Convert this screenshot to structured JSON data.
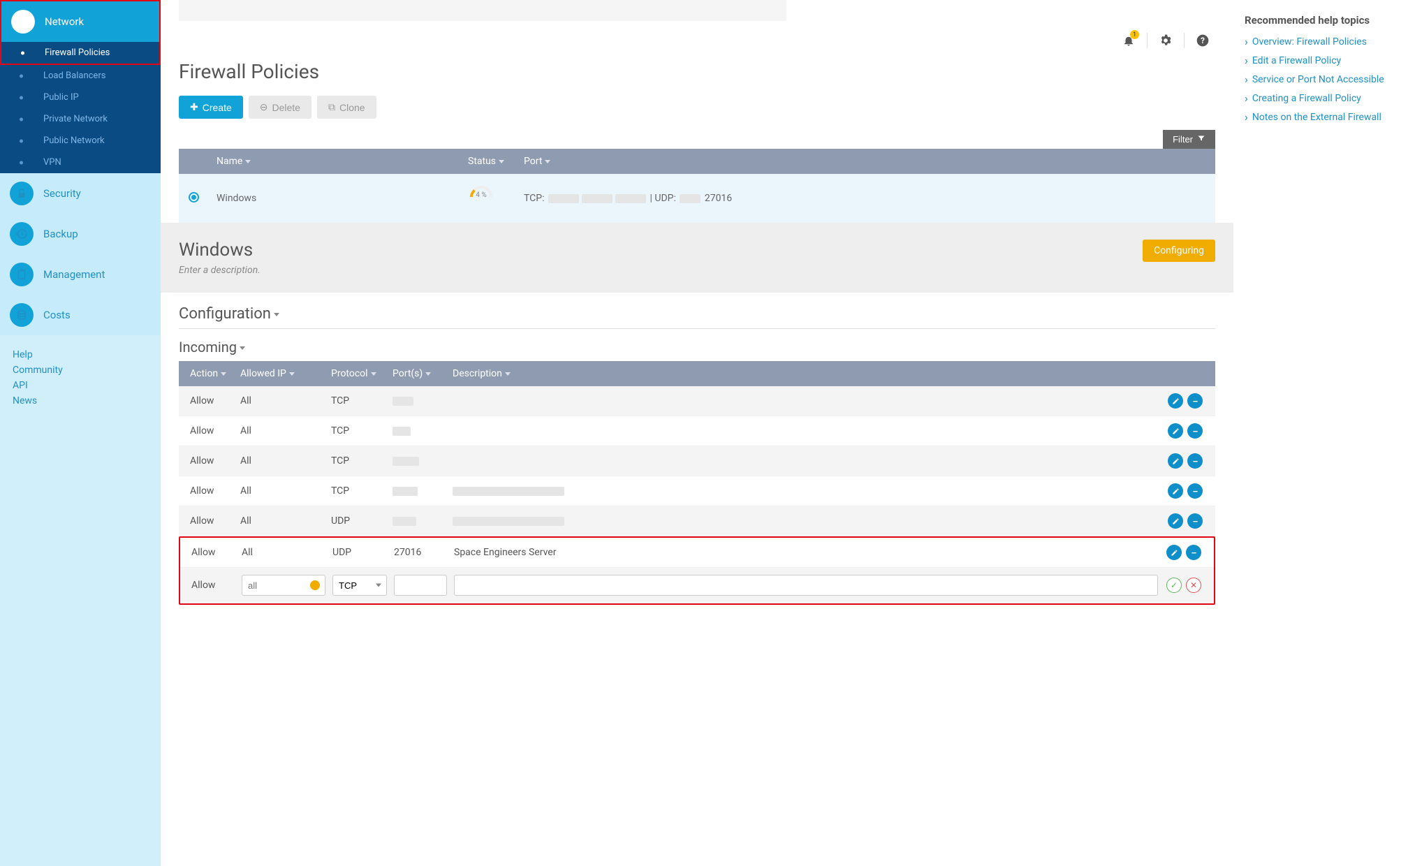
{
  "sidebar": {
    "sections": [
      {
        "label": "Network",
        "active": true
      },
      {
        "label": "Security",
        "active": false
      },
      {
        "label": "Backup",
        "active": false
      },
      {
        "label": "Management",
        "active": false
      },
      {
        "label": "Costs",
        "active": false
      }
    ],
    "network_items": [
      {
        "label": "Firewall Policies",
        "active": true
      },
      {
        "label": "Load Balancers",
        "active": false
      },
      {
        "label": "Public IP",
        "active": false
      },
      {
        "label": "Private Network",
        "active": false
      },
      {
        "label": "Public Network",
        "active": false
      },
      {
        "label": "VPN",
        "active": false
      }
    ],
    "bottom_links": [
      "Help",
      "Community",
      "API",
      "News"
    ]
  },
  "toolbar": {
    "notification_count": "1"
  },
  "page": {
    "title": "Firewall Policies",
    "buttons": {
      "create": "Create",
      "delete": "Delete",
      "clone": "Clone"
    },
    "filter": "Filter"
  },
  "policies": {
    "headers": {
      "name": "Name",
      "status": "Status",
      "port": "Port"
    },
    "rows": [
      {
        "name": "Windows",
        "status_pct": "4 %",
        "port_prefix": "TCP:",
        "port_mid": "| UDP:",
        "port_suffix": "27016"
      }
    ]
  },
  "detail": {
    "name": "Windows",
    "desc_placeholder": "Enter a description.",
    "status": "Configuring"
  },
  "config": {
    "title": "Configuration",
    "incoming_title": "Incoming",
    "headers": {
      "action": "Action",
      "ip": "Allowed IP",
      "proto": "Protocol",
      "ports": "Port(s)",
      "desc": "Description"
    },
    "rules": [
      {
        "action": "Allow",
        "ip": "All",
        "proto": "TCP",
        "ports_redacted": true,
        "ports_w": 30,
        "desc": "",
        "desc_redacted": false
      },
      {
        "action": "Allow",
        "ip": "All",
        "proto": "TCP",
        "ports_redacted": true,
        "ports_w": 26,
        "desc": "",
        "desc_redacted": false
      },
      {
        "action": "Allow",
        "ip": "All",
        "proto": "TCP",
        "ports_redacted": true,
        "ports_w": 38,
        "desc": "",
        "desc_redacted": false
      },
      {
        "action": "Allow",
        "ip": "All",
        "proto": "TCP",
        "ports_redacted": true,
        "ports_w": 36,
        "desc": "",
        "desc_redacted": true,
        "desc_w": 160
      },
      {
        "action": "Allow",
        "ip": "All",
        "proto": "UDP",
        "ports_redacted": true,
        "ports_w": 34,
        "desc": "",
        "desc_redacted": true,
        "desc_w": 160
      },
      {
        "action": "Allow",
        "ip": "All",
        "proto": "UDP",
        "ports": "27016",
        "ports_redacted": false,
        "desc": "Space Engineers Server",
        "desc_redacted": false
      }
    ],
    "new_rule": {
      "action": "Allow",
      "ip_placeholder": "all",
      "proto_value": "TCP",
      "ports_value": "",
      "desc_value": ""
    }
  },
  "help": {
    "title": "Recommended help topics",
    "links": [
      "Overview: Firewall Policies",
      "Edit a Firewall Policy",
      "Service or Port Not Accessible",
      "Creating a Firewall Policy",
      "Notes on the External Firewall"
    ]
  }
}
